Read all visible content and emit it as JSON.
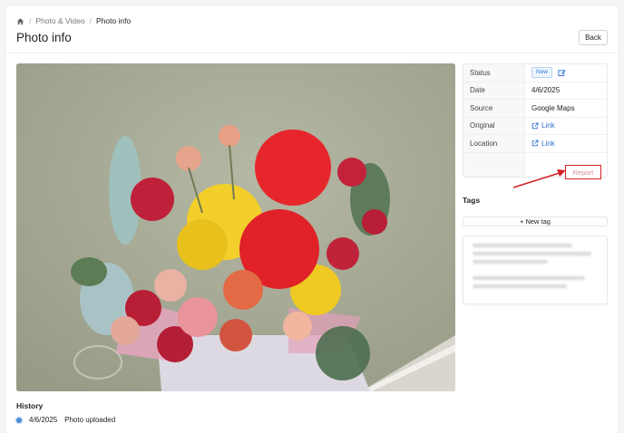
{
  "breadcrumb": {
    "items": [
      "Photo & Video",
      "Photo info"
    ]
  },
  "page": {
    "title": "Photo info",
    "back_label": "Back"
  },
  "info": {
    "rows": [
      {
        "key": "Status",
        "badge": "New"
      },
      {
        "key": "Date",
        "value": "4/6/2025"
      },
      {
        "key": "Source",
        "value": "Google Maps"
      },
      {
        "key": "Original",
        "link": "Link"
      },
      {
        "key": "Location",
        "link": "Link"
      }
    ],
    "report_label": "Report"
  },
  "tags": {
    "title": "Tags",
    "new_tag_label": "+ New tag"
  },
  "history": {
    "title": "History",
    "items": [
      {
        "date": "4/6/2025",
        "text": "Photo uploaded"
      }
    ]
  },
  "colors": {
    "accent": "#2f6fd0",
    "report_border": "#d3212b",
    "badge_bg": "#eef5fd"
  },
  "icons": [
    "home-icon",
    "edit-icon",
    "external-link-icon",
    "arrow-annotation"
  ]
}
